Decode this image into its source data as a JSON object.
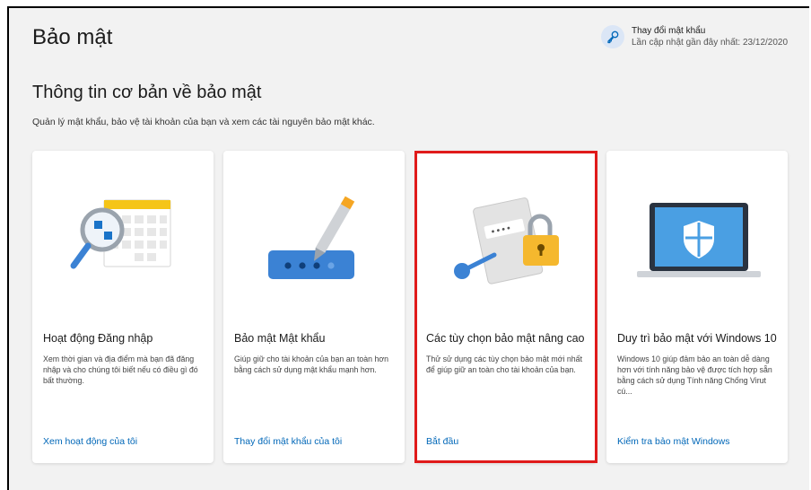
{
  "header": {
    "title": "Bảo mật",
    "change_password": {
      "label": "Thay đổi mật khẩu",
      "last_updated": "Lần cập nhật gần đây nhất: 23/12/2020",
      "icon": "key-icon"
    }
  },
  "section": {
    "title": "Thông tin cơ bản về bảo mật",
    "description": "Quản lý mật khẩu, bảo vệ tài khoản của bạn và xem các tài nguyên bảo mật khác."
  },
  "cards": [
    {
      "title": "Hoạt động Đăng nhập",
      "description": "Xem thời gian và địa điểm mà bạn đã đăng nhập và cho chúng tôi biết nếu có điều gì đó bất thường.",
      "action": "Xem hoạt động của tôi",
      "icon": "calendar-magnifier-icon"
    },
    {
      "title": "Bảo mật Mật khẩu",
      "description": "Giúp giữ cho tài khoản của bạn an toàn hơn bằng cách sử dụng mật khẩu mạnh hơn.",
      "action": "Thay đổi mật khẩu của tôi",
      "icon": "password-field-pen-icon"
    },
    {
      "title": "Các tùy chọn bảo mật nâng cao",
      "description": "Thử sử dụng các tùy chọn bảo mật mới nhất để giúp giữ an toàn cho tài khoản của bạn.",
      "action": "Bắt đầu",
      "icon": "padlock-key-icon"
    },
    {
      "title": "Duy trì bảo mật với Windows 10",
      "description": "Windows 10 giúp đảm bảo an toàn dễ dàng hơn với tính năng bảo vệ được tích hợp sẵn bằng cách sử dụng Tính năng Chống Virut cú...",
      "action": "Kiểm tra bảo mật Windows",
      "icon": "laptop-shield-icon"
    }
  ],
  "colors": {
    "link": "#0067b8",
    "highlight": "#e01a1a",
    "background": "#f2f2f2"
  }
}
